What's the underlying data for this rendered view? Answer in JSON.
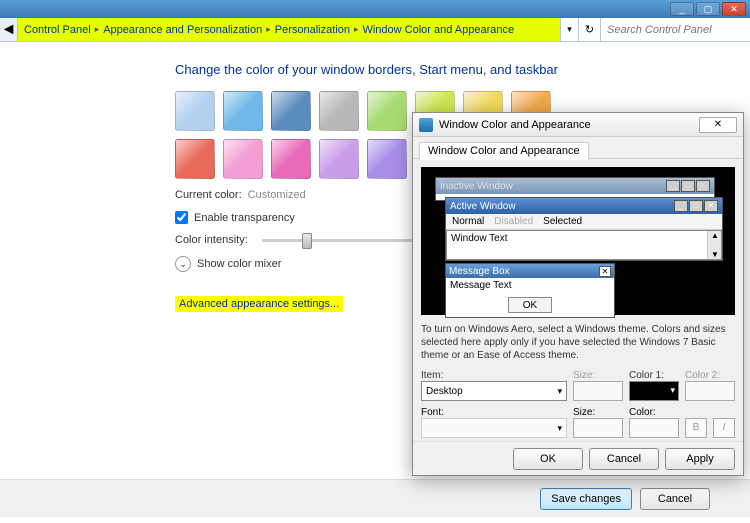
{
  "breadcrumb": {
    "items": [
      "Control Panel",
      "Appearance and Personalization",
      "Personalization",
      "Window Color and Appearance"
    ]
  },
  "search": {
    "placeholder": "Search Control Panel"
  },
  "page": {
    "heading": "Change the color of your window borders, Start menu, and taskbar",
    "current_color_label": "Current color:",
    "current_color_value": "Customized",
    "enable_transparency": "Enable transparency",
    "color_intensity": "Color intensity:",
    "show_color_mixer": "Show color mixer",
    "advanced_link": "Advanced appearance settings..."
  },
  "swatches": [
    "#b4d0f0",
    "#6fb8e8",
    "#5c8dbf",
    "#b8b8b8",
    "#a8db72",
    "#cde84f",
    "#f2d85a",
    "#f2a84a",
    "#e86a5a",
    "#f29ed4",
    "#e86ab8",
    "#c99ee8",
    "#a88ee8",
    "#8a6b4f",
    "#9eb8c8",
    "#d8d0b8"
  ],
  "footer": {
    "save": "Save changes",
    "cancel": "Cancel"
  },
  "dialog": {
    "title": "Window Color and Appearance",
    "tab": "Window Color and Appearance",
    "inactive": "Inactive Window",
    "active": "Active Window",
    "menu_normal": "Normal",
    "menu_disabled": "Disabled",
    "menu_selected": "Selected",
    "window_text": "Window Text",
    "message_box": "Message Box",
    "message_text": "Message Text",
    "ok_small": "OK",
    "help": "To turn on Windows Aero, select a Windows theme.  Colors and sizes selected here apply only if you have selected the Windows 7 Basic theme or an Ease of Access theme.",
    "item_label": "Item:",
    "item_value": "Desktop",
    "size_label": "Size:",
    "color1_label": "Color 1:",
    "color2_label": "Color 2:",
    "font_label": "Font:",
    "color_label": "Color:",
    "bold": "B",
    "italic": "I",
    "ok": "OK",
    "cancel": "Cancel",
    "apply": "Apply"
  }
}
